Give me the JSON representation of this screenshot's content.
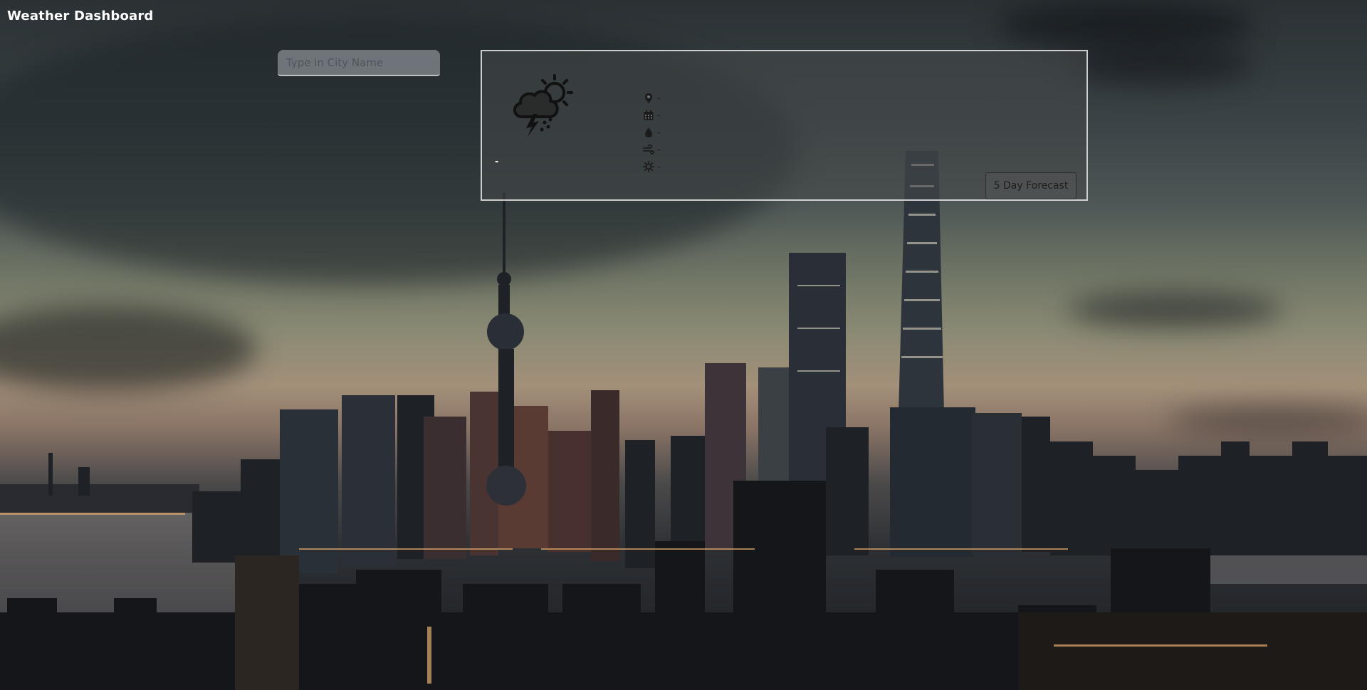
{
  "app": {
    "title": "Weather Dashboard"
  },
  "search": {
    "placeholder": "Type in City Name",
    "value": ""
  },
  "current_weather": {
    "icon": "thunderstorm-sun-icon",
    "temperature": "-",
    "location": "-",
    "date": "-",
    "humidity": "-",
    "wind": "-",
    "uv_index": "-",
    "detail_icons": [
      "map-pin-icon",
      "calendar-icon",
      "droplet-icon",
      "wind-icon",
      "sun-icon"
    ]
  },
  "forecast_button": {
    "label": "5 Day Forecast"
  }
}
